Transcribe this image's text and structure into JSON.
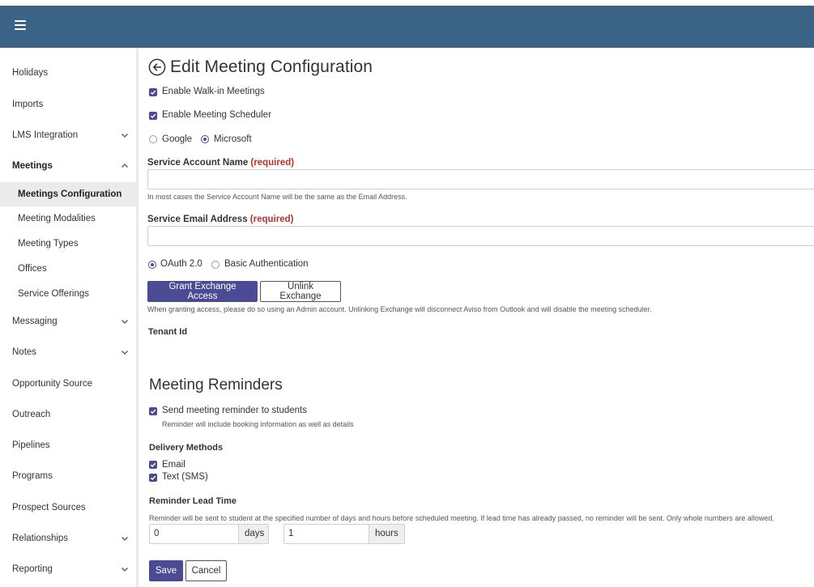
{
  "topbar": {
    "menu_icon": "hamburger-icon"
  },
  "sidebar": {
    "items": [
      {
        "label": "Holidays",
        "chevron": ""
      },
      {
        "label": "Imports",
        "chevron": ""
      },
      {
        "label": "LMS Integration",
        "chevron": "down"
      },
      {
        "label": "Meetings",
        "chevron": "up"
      },
      {
        "label": "Meetings Configuration",
        "chevron": ""
      },
      {
        "label": "Meeting Modalities",
        "chevron": ""
      },
      {
        "label": "Meeting Types",
        "chevron": ""
      },
      {
        "label": "Offices",
        "chevron": ""
      },
      {
        "label": "Service Offerings",
        "chevron": ""
      },
      {
        "label": "Messaging",
        "chevron": "down"
      },
      {
        "label": "Notes",
        "chevron": "down"
      },
      {
        "label": "Opportunity Source",
        "chevron": ""
      },
      {
        "label": "Outreach",
        "chevron": ""
      },
      {
        "label": "Pipelines",
        "chevron": ""
      },
      {
        "label": "Programs",
        "chevron": ""
      },
      {
        "label": "Prospect Sources",
        "chevron": ""
      },
      {
        "label": "Relationships",
        "chevron": "down"
      },
      {
        "label": "Reporting",
        "chevron": "down"
      }
    ]
  },
  "page": {
    "title": "Edit Meeting Configuration",
    "enable_walkin": "Enable Walk-in Meetings",
    "enable_scheduler": "Enable Meeting Scheduler",
    "provider_google": "Google",
    "provider_microsoft": "Microsoft",
    "service_account_label": "Service Account Name",
    "required": "(required)",
    "service_account_help": "In most cases the Service Account Name will be the same as the Email Address.",
    "service_email_label": "Service Email Address",
    "auth_oauth": "OAuth 2.0",
    "auth_basic": "Basic Authentication",
    "grant_button": "Grant Exchange Access",
    "unlink_button": "Unlink Exchange",
    "exchange_help": "When granting access, please do so using an Admin account. Unlinking Exchange will disconnect Aviso from Outlook and will disable the meeting scheduler.",
    "tenant_label": "Tenant Id"
  },
  "reminders": {
    "heading": "Meeting Reminders",
    "send_label": "Send meeting reminder to students",
    "send_help": "Reminder will include booking information as well as details",
    "delivery_label": "Delivery Methods",
    "email_label": "Email",
    "sms_label": "Text (SMS)",
    "lead_label": "Reminder Lead Time",
    "lead_help": "Reminder will be sent to student at the specified number of days and hours before scheduled meeting. If lead time has already passed, no reminder will be sent. Only whole numbers are allowed.",
    "days_value": "0",
    "days_unit": "days",
    "hours_value": "1",
    "hours_unit": "hours"
  },
  "actions": {
    "save": "Save",
    "cancel": "Cancel"
  },
  "colors": {
    "topbar": "#3b6386",
    "accent": "#4b4a94",
    "required": "#b8312f"
  }
}
